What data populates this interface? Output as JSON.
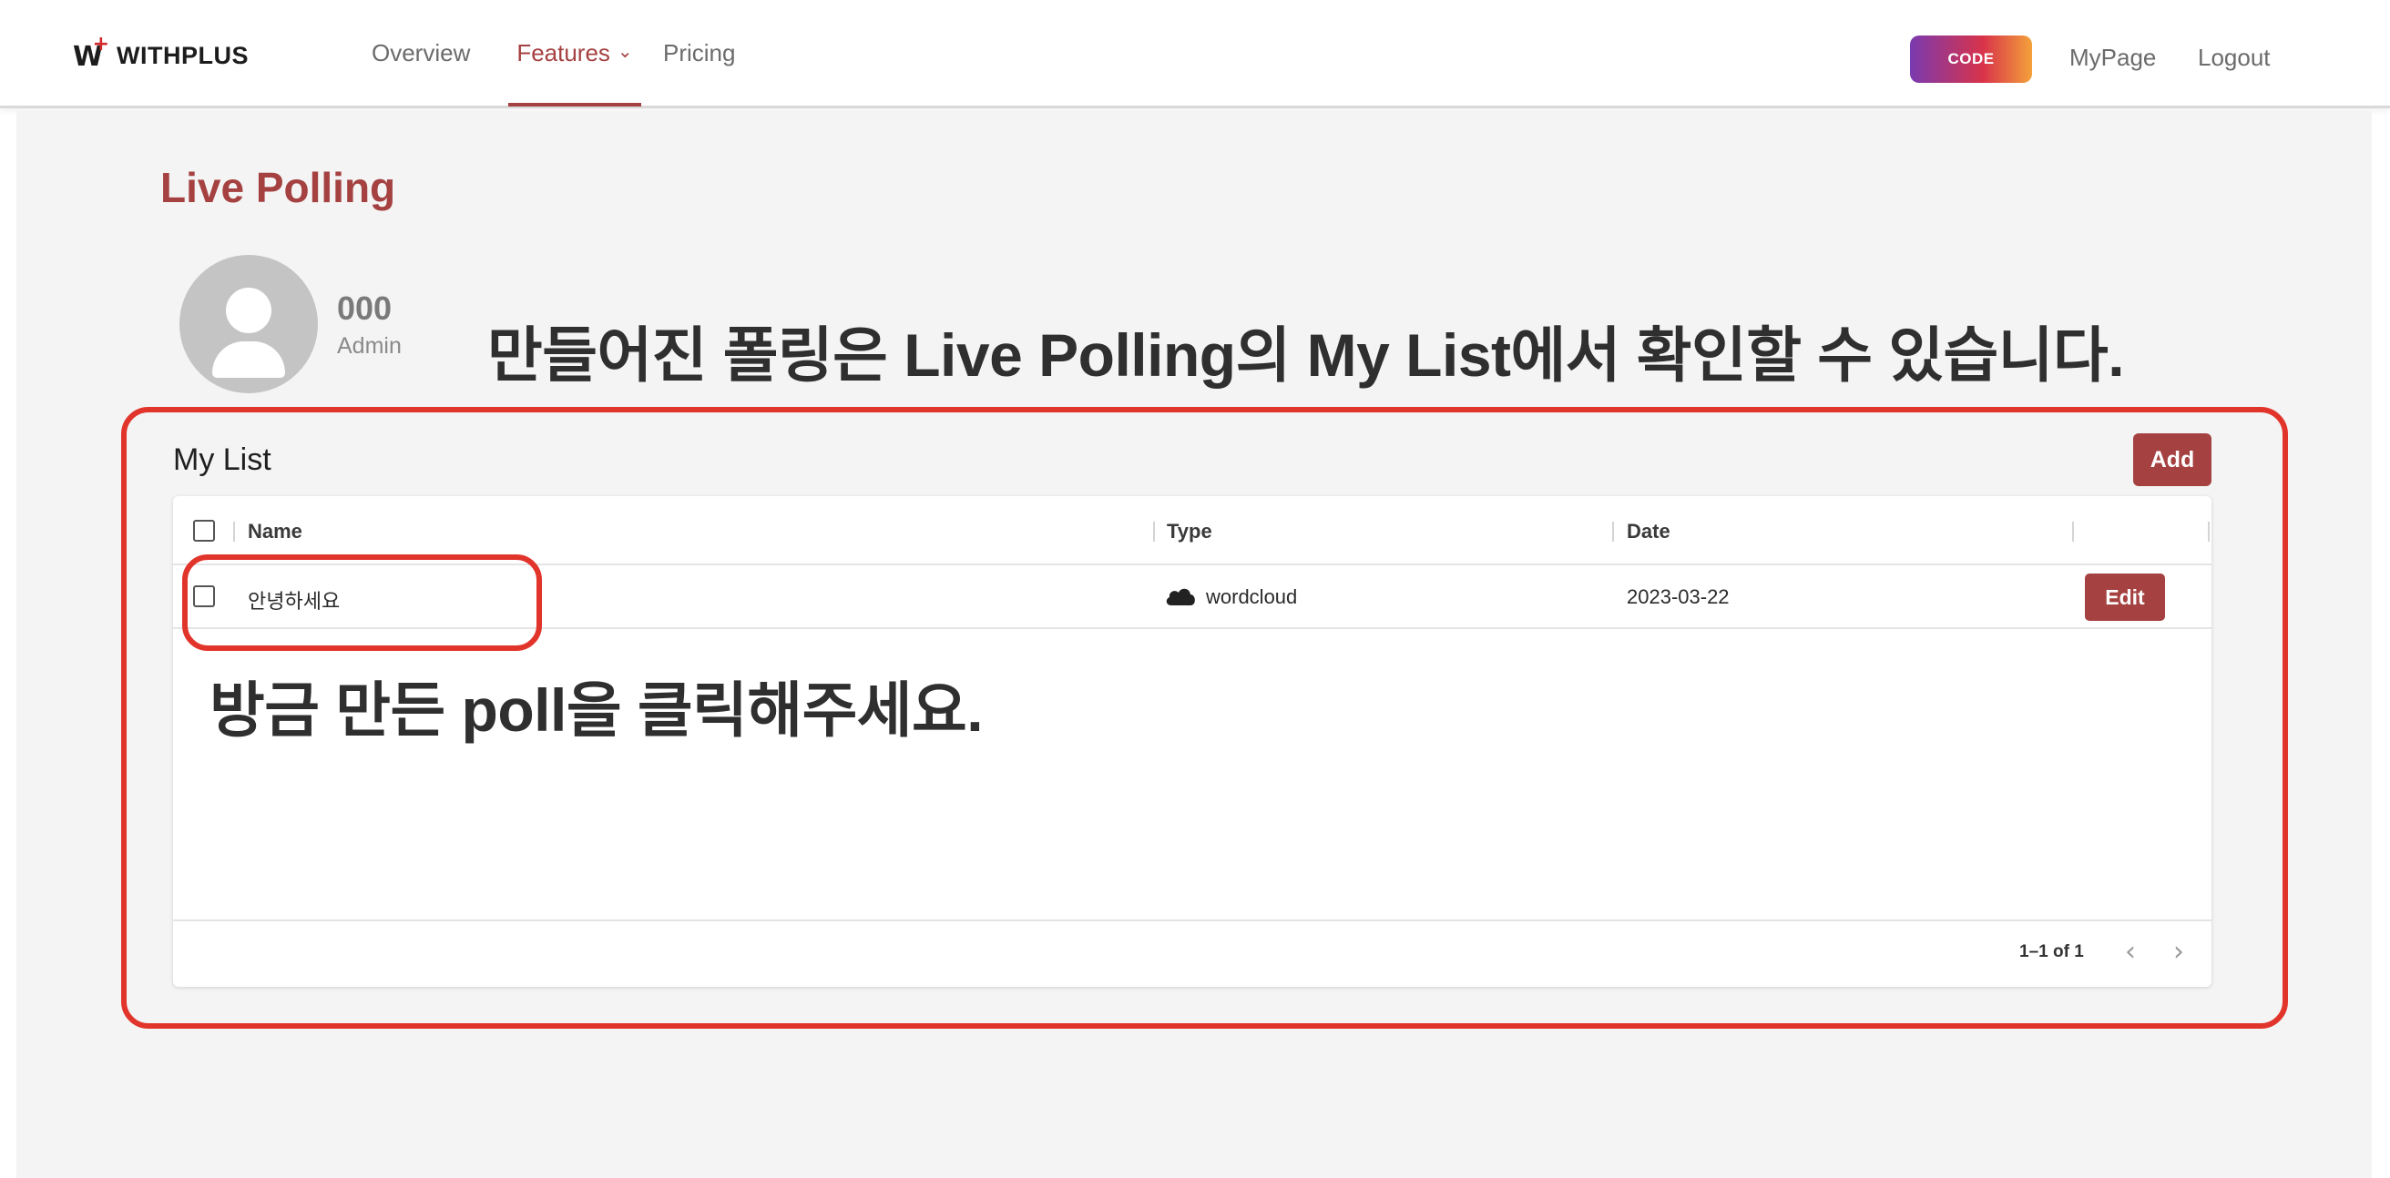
{
  "header": {
    "logo_text": "WITHPLUS",
    "nav": {
      "overview": "Overview",
      "features": "Features",
      "pricing": "Pricing"
    },
    "code_button": "CODE",
    "mypage": "MyPage",
    "logout": "Logout"
  },
  "page": {
    "title": "Live Polling"
  },
  "user": {
    "name": "000",
    "role": "Admin"
  },
  "annotations": {
    "top": "만들어진 폴링은 Live Polling의 My List에서 확인할 수 있습니다.",
    "middle": "방금 만든 poll을 클릭해주세요."
  },
  "my_list": {
    "title": "My List",
    "add_label": "Add",
    "columns": [
      "Name",
      "Type",
      "Date"
    ],
    "rows": [
      {
        "name": "안녕하세요",
        "type": "wordcloud",
        "type_icon": "cloud-icon",
        "date": "2023-03-22",
        "action": "Edit"
      }
    ],
    "pagination": "1–1 of 1"
  },
  "colors": {
    "brand": "#a54141",
    "annotation_outline": "#e1342b",
    "code_gradient": [
      "#7a3ab0",
      "#d8334a",
      "#f4a13a"
    ]
  }
}
